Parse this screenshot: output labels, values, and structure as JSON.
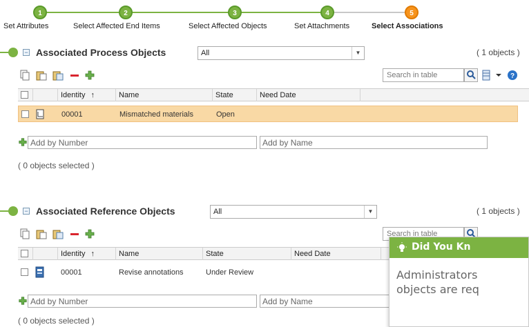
{
  "wizard": {
    "steps": [
      {
        "number": "1",
        "label": "Set Attributes",
        "state": "done"
      },
      {
        "number": "2",
        "label": "Select Affected End Items",
        "state": "done"
      },
      {
        "number": "3",
        "label": "Select Affected Objects",
        "state": "done"
      },
      {
        "number": "4",
        "label": "Set Attachments",
        "state": "done"
      },
      {
        "number": "5",
        "label": "Select Associations",
        "state": "active"
      }
    ]
  },
  "process": {
    "title": "Associated Process Objects",
    "filter": "All",
    "count": "( 1 objects )",
    "search_placeholder": "Search in table",
    "columns": {
      "identity": "Identity",
      "sort": "↑",
      "name": "Name",
      "state": "State",
      "need_date": "Need Date"
    },
    "rows": [
      {
        "identity": "00001",
        "name": "Mismatched materials",
        "state": "Open",
        "need_date": "",
        "selected": true
      }
    ],
    "add_number_placeholder": "Add by Number",
    "add_name_placeholder": "Add by Name",
    "selected_count": "( 0 objects selected )"
  },
  "reference": {
    "title": "Associated Reference Objects",
    "filter": "All",
    "count": "( 1 objects )",
    "search_placeholder": "Search in table",
    "columns": {
      "identity": "Identity",
      "sort": "↑",
      "name": "Name",
      "state": "State",
      "need_date": "Need Date"
    },
    "rows": [
      {
        "identity": "00001",
        "name": "Revise annotations",
        "state": "Under Review",
        "need_date": "",
        "selected": false
      }
    ],
    "add_number_placeholder": "Add by Number",
    "add_name_placeholder": "Add by Name",
    "selected_count": "( 0 objects selected )"
  },
  "tip": {
    "title": "Did You Kn",
    "body_line1": "Administrators",
    "body_line2": "objects are req"
  },
  "colors": {
    "accent_green": "#7cb342",
    "active_orange": "#f7941d",
    "selected_row": "#f9d9a5"
  }
}
